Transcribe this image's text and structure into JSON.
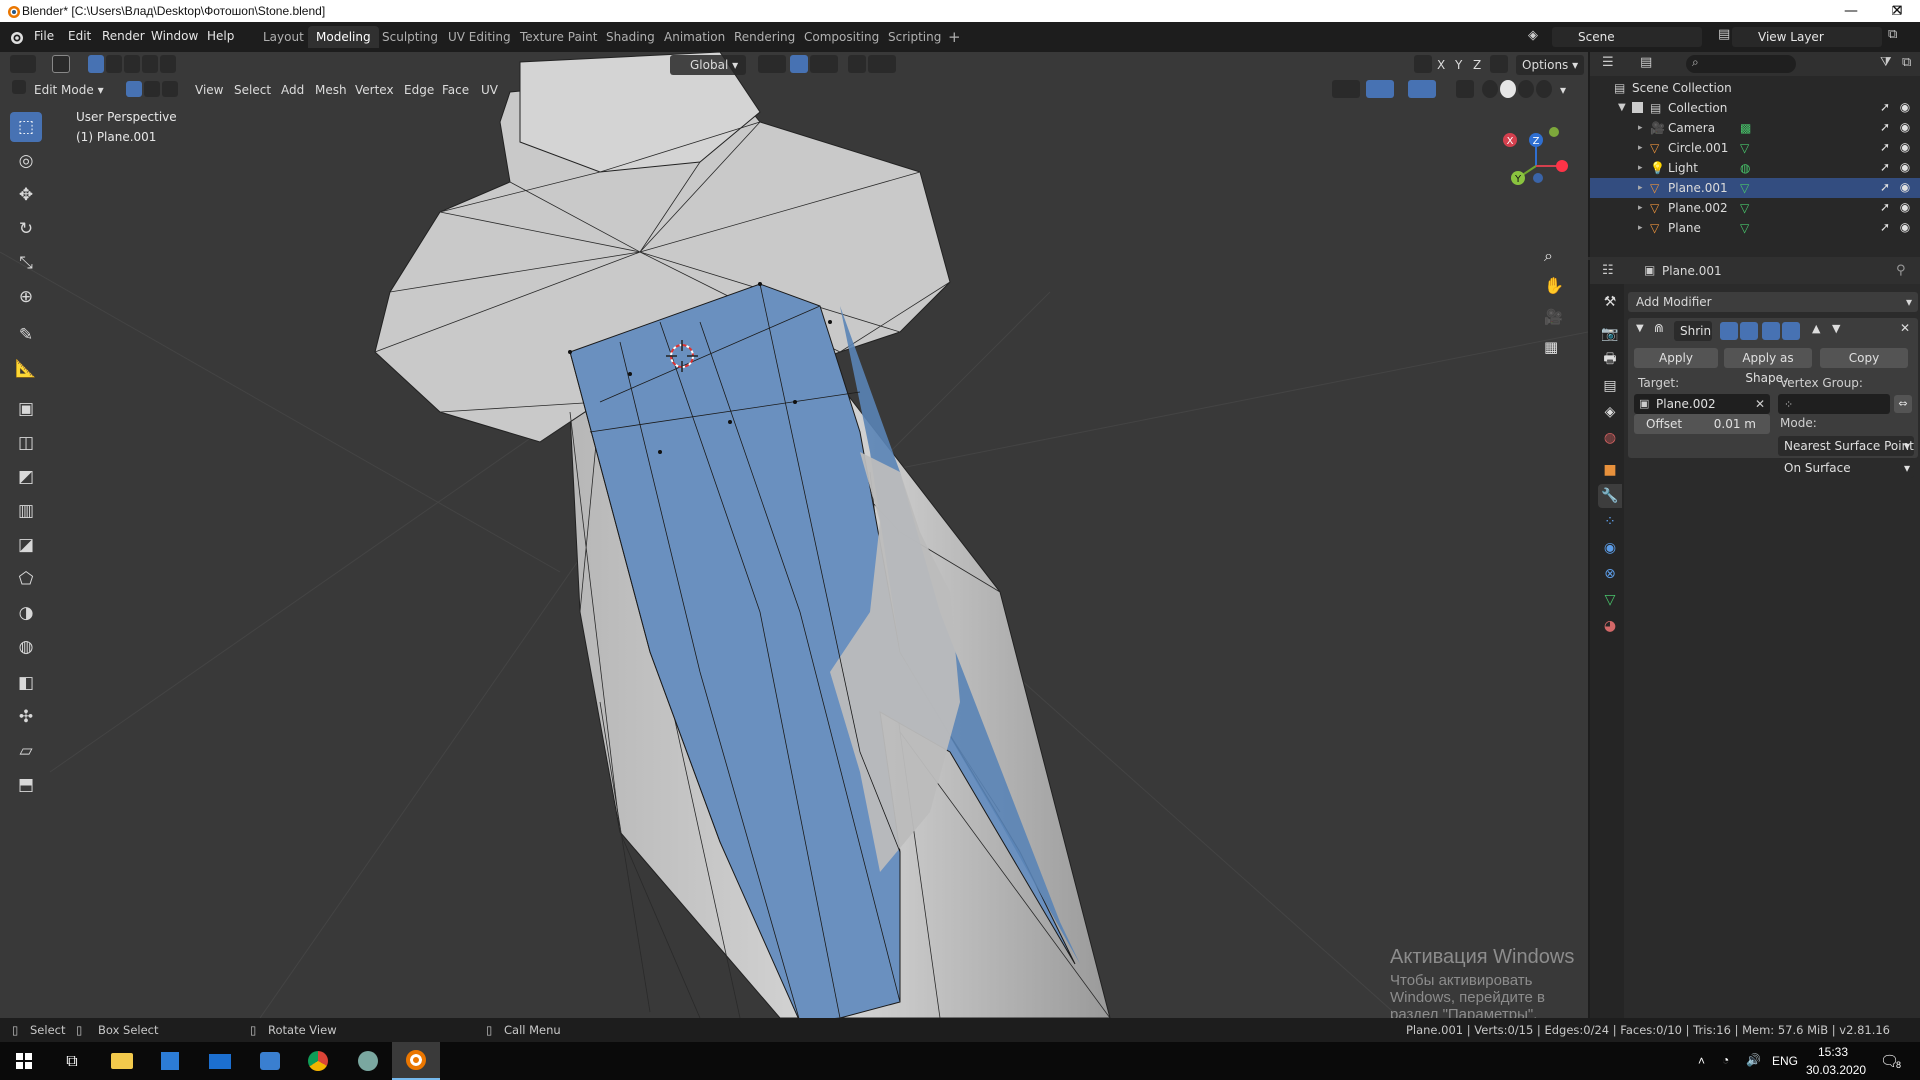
{
  "window": {
    "title": "Blender* [C:\\Users\\Влад\\Desktop\\Фотошоп\\Stone.blend]",
    "minimize": "—",
    "maximize": "❐",
    "close": "✕"
  },
  "menu": [
    "File",
    "Edit",
    "Render",
    "Window",
    "Help"
  ],
  "workspaces": [
    {
      "label": "Layout",
      "active": false
    },
    {
      "label": "Modeling",
      "active": true
    },
    {
      "label": "Sculpting",
      "active": false
    },
    {
      "label": "UV Editing",
      "active": false
    },
    {
      "label": "Texture Paint",
      "active": false
    },
    {
      "label": "Shading",
      "active": false
    },
    {
      "label": "Animation",
      "active": false
    },
    {
      "label": "Rendering",
      "active": false
    },
    {
      "label": "Compositing",
      "active": false
    },
    {
      "label": "Scripting",
      "active": false
    }
  ],
  "add_workspace": "+",
  "scene": {
    "name": "Scene",
    "view_layer": "View Layer"
  },
  "viewport_header": {
    "transform_orientation": "Global",
    "options": "Options",
    "axes": [
      "X",
      "Y",
      "Z"
    ],
    "mode": "Edit Mode",
    "menus": [
      "View",
      "Select",
      "Add",
      "Mesh",
      "Vertex",
      "Edge",
      "Face",
      "UV"
    ]
  },
  "viewport_overlay": {
    "perspective": "User Perspective",
    "object": "(1) Plane.001"
  },
  "gizmo": {
    "x": "X",
    "y": "Y",
    "z": "Z"
  },
  "tools": [
    {
      "icon": "select-box-icon",
      "glyph": "⬚",
      "active": true
    },
    {
      "icon": "cursor-icon",
      "glyph": "◎"
    },
    {
      "icon": "move-icon",
      "glyph": "✥"
    },
    {
      "icon": "rotate-icon",
      "glyph": "↻"
    },
    {
      "icon": "scale-icon",
      "glyph": "⤡"
    },
    {
      "icon": "transform-icon",
      "glyph": "⊕"
    },
    {
      "icon": "annotate-icon",
      "glyph": "✎"
    },
    {
      "icon": "measure-icon",
      "glyph": "📐"
    },
    {
      "icon": "extrude-icon",
      "glyph": "▣"
    },
    {
      "icon": "inset-icon",
      "glyph": "◫"
    },
    {
      "icon": "bevel-icon",
      "glyph": "◩"
    },
    {
      "icon": "loop-cut-icon",
      "glyph": "▥"
    },
    {
      "icon": "knife-icon",
      "glyph": "◪"
    },
    {
      "icon": "poly-build-icon",
      "glyph": "⬠"
    },
    {
      "icon": "spin-icon",
      "glyph": "◑"
    },
    {
      "icon": "smooth-icon",
      "glyph": "◍"
    },
    {
      "icon": "edge-slide-icon",
      "glyph": "◧"
    },
    {
      "icon": "shrink-fatten-icon",
      "glyph": "✣"
    },
    {
      "icon": "shear-icon",
      "glyph": "▱"
    },
    {
      "icon": "rip-region-icon",
      "glyph": "⬒"
    }
  ],
  "outliner": {
    "root": "Scene Collection",
    "collection": "Collection",
    "items": [
      {
        "name": "Camera",
        "type": "camera"
      },
      {
        "name": "Circle.001",
        "type": "mesh"
      },
      {
        "name": "Light",
        "type": "light"
      },
      {
        "name": "Plane.001",
        "type": "mesh",
        "selected": true
      },
      {
        "name": "Plane.002",
        "type": "mesh"
      },
      {
        "name": "Plane",
        "type": "mesh"
      }
    ]
  },
  "properties": {
    "object_name": "Plane.001",
    "add_modifier": "Add Modifier",
    "modifier_name": "Shrin",
    "apply": "Apply",
    "apply_as_shape": "Apply as Shape..",
    "copy": "Copy",
    "target_label": "Target:",
    "target_value": "Plane.002",
    "vertex_group_label": "Vertex Group:",
    "offset_label": "Offset",
    "offset_value": "0.01 m",
    "mode_label": "Mode:",
    "mode_value": "Nearest Surface Point",
    "snap_mode": "On Surface"
  },
  "watermark": {
    "line1": "Активация Windows",
    "line2": "Чтобы активировать Windows, перейдите в раздел \"Параметры\"."
  },
  "statusbar": {
    "select": "Select",
    "box_select": "Box Select",
    "rotate_view": "Rotate View",
    "call_menu": "Call Menu",
    "stats": "Plane.001 | Verts:0/15 | Edges:0/24 | Faces:0/10 | Tris:16 | Mem: 57.6 MiB | v2.81.16"
  },
  "taskbar": {
    "lang": "ENG",
    "time": "15:33",
    "date": "30.03.2020",
    "notifications": "8"
  }
}
